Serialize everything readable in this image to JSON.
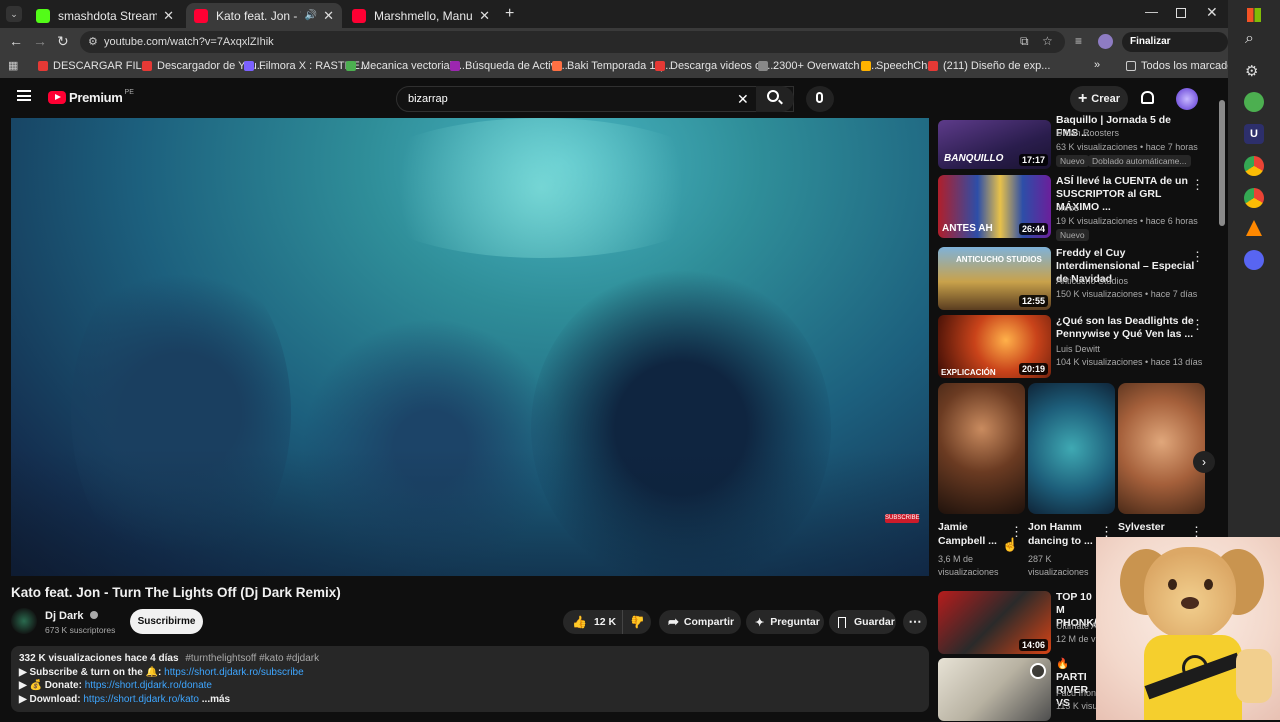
{
  "browser": {
    "tabs": [
      {
        "title": "smashdota Stream - Watch Live",
        "color": "#53fc18",
        "active": false
      },
      {
        "title": "Kato feat. Jon - Turn The Li",
        "color": "#ff0033",
        "active": true
      },
      {
        "title": "Marshmello, Manuel Turizo - El",
        "color": "#ff0033",
        "active": false
      }
    ],
    "url": "youtube.com/watch?v=7AxqxlZIhik",
    "update_button": "Finalizar actualización",
    "bookmarks": [
      {
        "label": "DESCARGAR FIL...",
        "color": "#e53935"
      },
      {
        "label": "Descargador de You...",
        "color": "#e53935"
      },
      {
        "label": "Filmora X : RASTRE...",
        "color": "#7b61ff"
      },
      {
        "label": "Mecanica vectorial-...",
        "color": "#4caf50"
      },
      {
        "label": "Búsqueda de Activi...",
        "color": "#9c27b0"
      },
      {
        "label": "Baki Temporada 1 (...",
        "color": "#ff7043"
      },
      {
        "label": "Descarga videos de...",
        "color": "#e53935"
      },
      {
        "label": "2300+ Overwatch F...",
        "color": "#888888"
      },
      {
        "label": "SpeechChat",
        "color": "#ffb300"
      },
      {
        "label": "(211) Diseño de exp...",
        "color": "#e53935"
      }
    ],
    "all_bookmarks": "Todos los marcadores"
  },
  "youtube": {
    "logo_text": "Premium",
    "logo_sup": "PE",
    "search_value": "bizarrap",
    "create_label": "Crear"
  },
  "video": {
    "title": "Kato feat. Jon - Turn The Lights Off (Dj Dark Remix)",
    "channel": "Dj Dark",
    "subscribers": "673 K suscriptores",
    "subscribe_label": "Suscribirme",
    "likes": "12 K",
    "share_label": "Compartir",
    "ask_label": "Preguntar",
    "save_label": "Guardar",
    "desc_stats": "332 K visualizaciones  hace 4 días",
    "desc_tags": "#turnthelightsoff #kato #djdark",
    "desc_lines": [
      {
        "prefix": "▶ Subscribe & turn on the 🔔: ",
        "link": "https://short.djdark.ro/subscribe"
      },
      {
        "prefix": "▶ 💰 Donate: ",
        "link": "https://short.djdark.ro/donate"
      },
      {
        "prefix": "▶ Download: ",
        "link": "https://short.djdark.ro/kato"
      }
    ],
    "more_label": "...más"
  },
  "sidebar": {
    "videos": [
      {
        "title": "Baquillo | Jornada 5 de FMS ...",
        "channel": "Urban Roosters",
        "stats": "63 K visualizaciones • hace 7 horas",
        "duration": "17:17",
        "badges": [
          "Nuevo",
          "Doblado automáticame..."
        ],
        "thumb_text": "BANQUILLO"
      },
      {
        "title": "ASÍ llevé la CUENTA de un SUSCRIPTOR al GRL MÁXIMO ...",
        "channel": "4nroo",
        "stats": "19 K visualizaciones • hace 6 horas",
        "duration": "26:44",
        "badges": [
          "Nuevo"
        ],
        "thumb_text": "ANTES  AH"
      },
      {
        "title": "Freddy el Cuy Interdimensional – Especial de Navidad",
        "channel": "Anticucho Studios",
        "stats": "150 K visualizaciones • hace 7 días",
        "duration": "12:55",
        "badges": [],
        "thumb_text": "ANTICUCHO STUDIOS"
      },
      {
        "title": "¿Qué son las Deadlights de Pennywise y Qué Ven las ...",
        "channel": "Luis Dewitt",
        "stats": "104 K visualizaciones • hace 13 días",
        "duration": "20:19",
        "badges": [],
        "thumb_text": "EXPLICACIÓN"
      }
    ],
    "shorts": [
      {
        "title1": "Jamie",
        "title2": "Campbell ...",
        "meta1": "3,6 M de",
        "meta2": "visualizaciones"
      },
      {
        "title1": "Jon Hamm",
        "title2": "dancing to ...",
        "meta1": "287 K",
        "meta2": "visualizaciones"
      },
      {
        "title1": "Sylvester",
        "title2": "",
        "meta1": "",
        "meta2": ""
      }
    ],
    "more_videos": [
      {
        "title": "TOP 10 M PHONK/F",
        "channel": "Ultimate A",
        "stats": "12 M de vi",
        "duration": "14:06"
      },
      {
        "title": "🔥PARTI RIVER VS",
        "channel": "Facu Irione",
        "stats": "113 K visu",
        "duration": ""
      }
    ]
  }
}
